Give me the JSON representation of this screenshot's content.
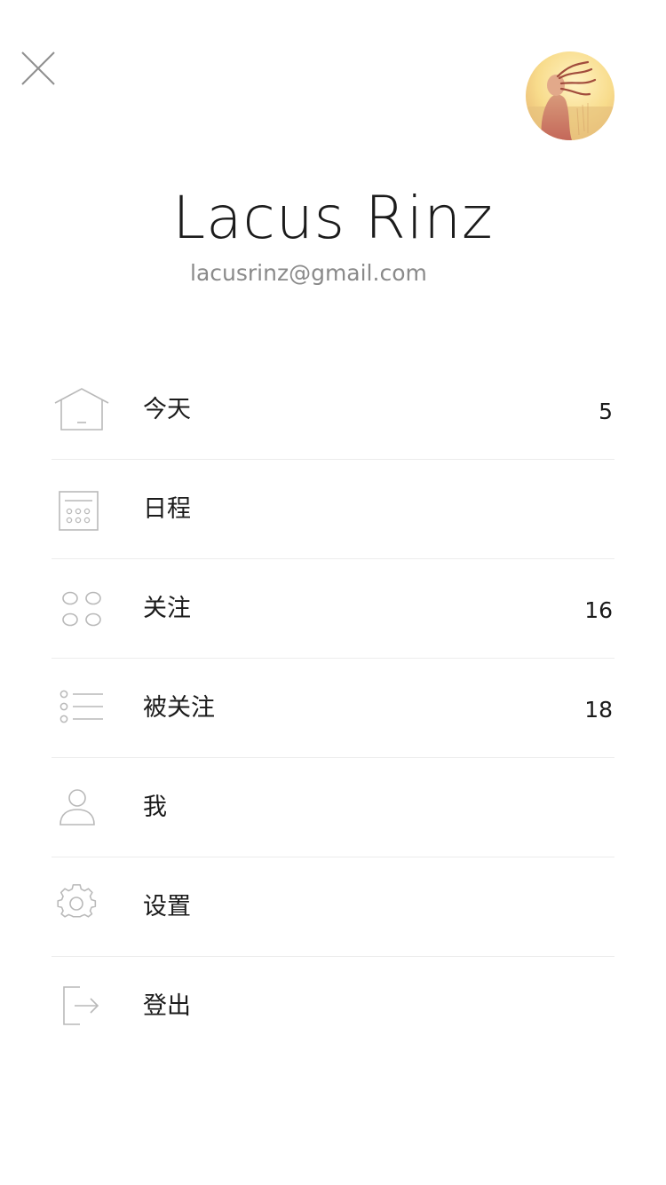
{
  "profile": {
    "name": "Lacus Rinz",
    "email": "lacusrinz@gmail.com",
    "avatar_icon": "avatar-photo"
  },
  "close_icon": "close-icon",
  "menu": {
    "items": [
      {
        "key": "today",
        "label": "今天",
        "count": "5",
        "icon": "home-icon"
      },
      {
        "key": "schedule",
        "label": "日程",
        "count": "",
        "icon": "calendar-icon"
      },
      {
        "key": "following",
        "label": "关注",
        "count": "16",
        "icon": "grid-circles-icon"
      },
      {
        "key": "followers",
        "label": "被关注",
        "count": "18",
        "icon": "list-icon"
      },
      {
        "key": "me",
        "label": "我",
        "count": "",
        "icon": "person-icon"
      },
      {
        "key": "settings",
        "label": "设置",
        "count": "",
        "icon": "gear-icon"
      },
      {
        "key": "logout",
        "label": "登出",
        "count": "",
        "icon": "logout-icon"
      }
    ]
  },
  "colors": {
    "icon_stroke": "#b9b9b9",
    "divider": "#ececec",
    "text": "#1b1b1b",
    "email": "#8a8a8a"
  }
}
